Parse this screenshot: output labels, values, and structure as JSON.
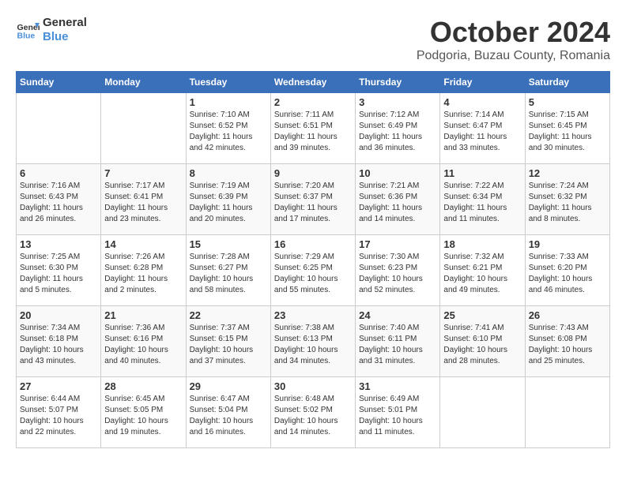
{
  "header": {
    "logo_line1": "General",
    "logo_line2": "Blue",
    "month": "October 2024",
    "location": "Podgoria, Buzau County, Romania"
  },
  "days_of_week": [
    "Sunday",
    "Monday",
    "Tuesday",
    "Wednesday",
    "Thursday",
    "Friday",
    "Saturday"
  ],
  "weeks": [
    [
      {
        "day": "",
        "info": ""
      },
      {
        "day": "",
        "info": ""
      },
      {
        "day": "1",
        "info": "Sunrise: 7:10 AM\nSunset: 6:52 PM\nDaylight: 11 hours and 42 minutes."
      },
      {
        "day": "2",
        "info": "Sunrise: 7:11 AM\nSunset: 6:51 PM\nDaylight: 11 hours and 39 minutes."
      },
      {
        "day": "3",
        "info": "Sunrise: 7:12 AM\nSunset: 6:49 PM\nDaylight: 11 hours and 36 minutes."
      },
      {
        "day": "4",
        "info": "Sunrise: 7:14 AM\nSunset: 6:47 PM\nDaylight: 11 hours and 33 minutes."
      },
      {
        "day": "5",
        "info": "Sunrise: 7:15 AM\nSunset: 6:45 PM\nDaylight: 11 hours and 30 minutes."
      }
    ],
    [
      {
        "day": "6",
        "info": "Sunrise: 7:16 AM\nSunset: 6:43 PM\nDaylight: 11 hours and 26 minutes."
      },
      {
        "day": "7",
        "info": "Sunrise: 7:17 AM\nSunset: 6:41 PM\nDaylight: 11 hours and 23 minutes."
      },
      {
        "day": "8",
        "info": "Sunrise: 7:19 AM\nSunset: 6:39 PM\nDaylight: 11 hours and 20 minutes."
      },
      {
        "day": "9",
        "info": "Sunrise: 7:20 AM\nSunset: 6:37 PM\nDaylight: 11 hours and 17 minutes."
      },
      {
        "day": "10",
        "info": "Sunrise: 7:21 AM\nSunset: 6:36 PM\nDaylight: 11 hours and 14 minutes."
      },
      {
        "day": "11",
        "info": "Sunrise: 7:22 AM\nSunset: 6:34 PM\nDaylight: 11 hours and 11 minutes."
      },
      {
        "day": "12",
        "info": "Sunrise: 7:24 AM\nSunset: 6:32 PM\nDaylight: 11 hours and 8 minutes."
      }
    ],
    [
      {
        "day": "13",
        "info": "Sunrise: 7:25 AM\nSunset: 6:30 PM\nDaylight: 11 hours and 5 minutes."
      },
      {
        "day": "14",
        "info": "Sunrise: 7:26 AM\nSunset: 6:28 PM\nDaylight: 11 hours and 2 minutes."
      },
      {
        "day": "15",
        "info": "Sunrise: 7:28 AM\nSunset: 6:27 PM\nDaylight: 10 hours and 58 minutes."
      },
      {
        "day": "16",
        "info": "Sunrise: 7:29 AM\nSunset: 6:25 PM\nDaylight: 10 hours and 55 minutes."
      },
      {
        "day": "17",
        "info": "Sunrise: 7:30 AM\nSunset: 6:23 PM\nDaylight: 10 hours and 52 minutes."
      },
      {
        "day": "18",
        "info": "Sunrise: 7:32 AM\nSunset: 6:21 PM\nDaylight: 10 hours and 49 minutes."
      },
      {
        "day": "19",
        "info": "Sunrise: 7:33 AM\nSunset: 6:20 PM\nDaylight: 10 hours and 46 minutes."
      }
    ],
    [
      {
        "day": "20",
        "info": "Sunrise: 7:34 AM\nSunset: 6:18 PM\nDaylight: 10 hours and 43 minutes."
      },
      {
        "day": "21",
        "info": "Sunrise: 7:36 AM\nSunset: 6:16 PM\nDaylight: 10 hours and 40 minutes."
      },
      {
        "day": "22",
        "info": "Sunrise: 7:37 AM\nSunset: 6:15 PM\nDaylight: 10 hours and 37 minutes."
      },
      {
        "day": "23",
        "info": "Sunrise: 7:38 AM\nSunset: 6:13 PM\nDaylight: 10 hours and 34 minutes."
      },
      {
        "day": "24",
        "info": "Sunrise: 7:40 AM\nSunset: 6:11 PM\nDaylight: 10 hours and 31 minutes."
      },
      {
        "day": "25",
        "info": "Sunrise: 7:41 AM\nSunset: 6:10 PM\nDaylight: 10 hours and 28 minutes."
      },
      {
        "day": "26",
        "info": "Sunrise: 7:43 AM\nSunset: 6:08 PM\nDaylight: 10 hours and 25 minutes."
      }
    ],
    [
      {
        "day": "27",
        "info": "Sunrise: 6:44 AM\nSunset: 5:07 PM\nDaylight: 10 hours and 22 minutes."
      },
      {
        "day": "28",
        "info": "Sunrise: 6:45 AM\nSunset: 5:05 PM\nDaylight: 10 hours and 19 minutes."
      },
      {
        "day": "29",
        "info": "Sunrise: 6:47 AM\nSunset: 5:04 PM\nDaylight: 10 hours and 16 minutes."
      },
      {
        "day": "30",
        "info": "Sunrise: 6:48 AM\nSunset: 5:02 PM\nDaylight: 10 hours and 14 minutes."
      },
      {
        "day": "31",
        "info": "Sunrise: 6:49 AM\nSunset: 5:01 PM\nDaylight: 10 hours and 11 minutes."
      },
      {
        "day": "",
        "info": ""
      },
      {
        "day": "",
        "info": ""
      }
    ]
  ]
}
